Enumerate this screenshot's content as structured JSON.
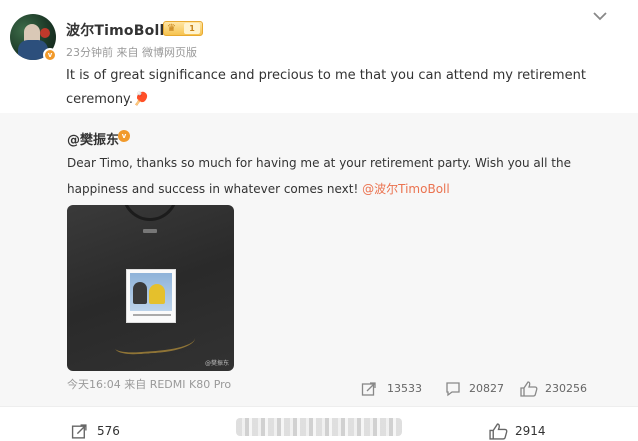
{
  "post": {
    "username": "波尔TimoBoll",
    "level": "1",
    "time": "23分钟前",
    "source": "来自 微博网页版",
    "text": "It is of great significance and precious to me that you can attend my retirement ceremony.🏓"
  },
  "repost": {
    "author": "@樊振东",
    "text_main": "Dear Timo, thanks so much for having me at your retirement party. Wish you all the happiness and success in whatever comes next!",
    "mention": "@波尔TimoBoll",
    "image_watermark": "@樊振东",
    "time": "今天16:04",
    "source": "来自 REDMI K80 Pro",
    "reposts": "13533",
    "comments": "20827",
    "likes": "230256"
  },
  "bottom": {
    "reposts": "576",
    "likes": "2914"
  },
  "colors": {
    "mention": "#eb7350",
    "badge": "#f19a2b",
    "repost_bg": "#f7f7f7"
  }
}
